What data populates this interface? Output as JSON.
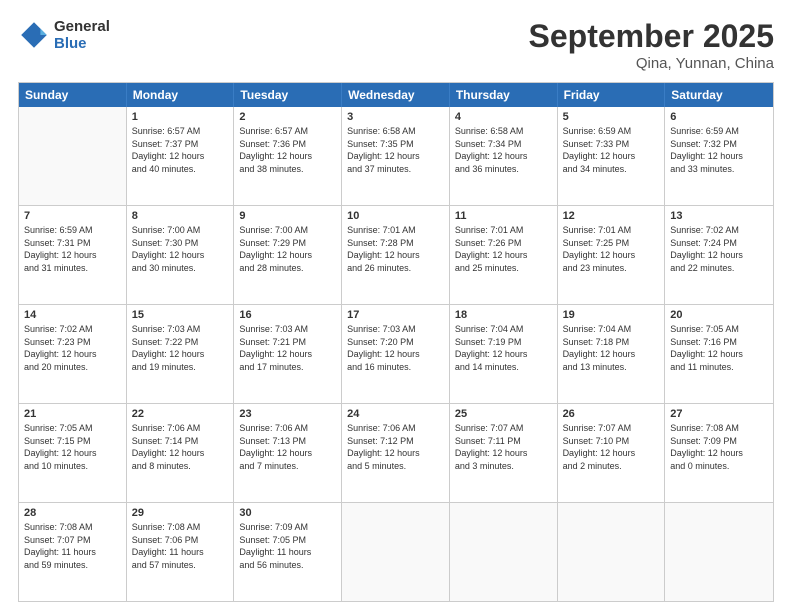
{
  "header": {
    "logo_line1": "General",
    "logo_line2": "Blue",
    "title": "September 2025",
    "subtitle": "Qina, Yunnan, China"
  },
  "days_of_week": [
    "Sunday",
    "Monday",
    "Tuesday",
    "Wednesday",
    "Thursday",
    "Friday",
    "Saturday"
  ],
  "weeks": [
    [
      {
        "day": "",
        "info": ""
      },
      {
        "day": "1",
        "info": "Sunrise: 6:57 AM\nSunset: 7:37 PM\nDaylight: 12 hours\nand 40 minutes."
      },
      {
        "day": "2",
        "info": "Sunrise: 6:57 AM\nSunset: 7:36 PM\nDaylight: 12 hours\nand 38 minutes."
      },
      {
        "day": "3",
        "info": "Sunrise: 6:58 AM\nSunset: 7:35 PM\nDaylight: 12 hours\nand 37 minutes."
      },
      {
        "day": "4",
        "info": "Sunrise: 6:58 AM\nSunset: 7:34 PM\nDaylight: 12 hours\nand 36 minutes."
      },
      {
        "day": "5",
        "info": "Sunrise: 6:59 AM\nSunset: 7:33 PM\nDaylight: 12 hours\nand 34 minutes."
      },
      {
        "day": "6",
        "info": "Sunrise: 6:59 AM\nSunset: 7:32 PM\nDaylight: 12 hours\nand 33 minutes."
      }
    ],
    [
      {
        "day": "7",
        "info": "Sunrise: 6:59 AM\nSunset: 7:31 PM\nDaylight: 12 hours\nand 31 minutes."
      },
      {
        "day": "8",
        "info": "Sunrise: 7:00 AM\nSunset: 7:30 PM\nDaylight: 12 hours\nand 30 minutes."
      },
      {
        "day": "9",
        "info": "Sunrise: 7:00 AM\nSunset: 7:29 PM\nDaylight: 12 hours\nand 28 minutes."
      },
      {
        "day": "10",
        "info": "Sunrise: 7:01 AM\nSunset: 7:28 PM\nDaylight: 12 hours\nand 26 minutes."
      },
      {
        "day": "11",
        "info": "Sunrise: 7:01 AM\nSunset: 7:26 PM\nDaylight: 12 hours\nand 25 minutes."
      },
      {
        "day": "12",
        "info": "Sunrise: 7:01 AM\nSunset: 7:25 PM\nDaylight: 12 hours\nand 23 minutes."
      },
      {
        "day": "13",
        "info": "Sunrise: 7:02 AM\nSunset: 7:24 PM\nDaylight: 12 hours\nand 22 minutes."
      }
    ],
    [
      {
        "day": "14",
        "info": "Sunrise: 7:02 AM\nSunset: 7:23 PM\nDaylight: 12 hours\nand 20 minutes."
      },
      {
        "day": "15",
        "info": "Sunrise: 7:03 AM\nSunset: 7:22 PM\nDaylight: 12 hours\nand 19 minutes."
      },
      {
        "day": "16",
        "info": "Sunrise: 7:03 AM\nSunset: 7:21 PM\nDaylight: 12 hours\nand 17 minutes."
      },
      {
        "day": "17",
        "info": "Sunrise: 7:03 AM\nSunset: 7:20 PM\nDaylight: 12 hours\nand 16 minutes."
      },
      {
        "day": "18",
        "info": "Sunrise: 7:04 AM\nSunset: 7:19 PM\nDaylight: 12 hours\nand 14 minutes."
      },
      {
        "day": "19",
        "info": "Sunrise: 7:04 AM\nSunset: 7:18 PM\nDaylight: 12 hours\nand 13 minutes."
      },
      {
        "day": "20",
        "info": "Sunrise: 7:05 AM\nSunset: 7:16 PM\nDaylight: 12 hours\nand 11 minutes."
      }
    ],
    [
      {
        "day": "21",
        "info": "Sunrise: 7:05 AM\nSunset: 7:15 PM\nDaylight: 12 hours\nand 10 minutes."
      },
      {
        "day": "22",
        "info": "Sunrise: 7:06 AM\nSunset: 7:14 PM\nDaylight: 12 hours\nand 8 minutes."
      },
      {
        "day": "23",
        "info": "Sunrise: 7:06 AM\nSunset: 7:13 PM\nDaylight: 12 hours\nand 7 minutes."
      },
      {
        "day": "24",
        "info": "Sunrise: 7:06 AM\nSunset: 7:12 PM\nDaylight: 12 hours\nand 5 minutes."
      },
      {
        "day": "25",
        "info": "Sunrise: 7:07 AM\nSunset: 7:11 PM\nDaylight: 12 hours\nand 3 minutes."
      },
      {
        "day": "26",
        "info": "Sunrise: 7:07 AM\nSunset: 7:10 PM\nDaylight: 12 hours\nand 2 minutes."
      },
      {
        "day": "27",
        "info": "Sunrise: 7:08 AM\nSunset: 7:09 PM\nDaylight: 12 hours\nand 0 minutes."
      }
    ],
    [
      {
        "day": "28",
        "info": "Sunrise: 7:08 AM\nSunset: 7:07 PM\nDaylight: 11 hours\nand 59 minutes."
      },
      {
        "day": "29",
        "info": "Sunrise: 7:08 AM\nSunset: 7:06 PM\nDaylight: 11 hours\nand 57 minutes."
      },
      {
        "day": "30",
        "info": "Sunrise: 7:09 AM\nSunset: 7:05 PM\nDaylight: 11 hours\nand 56 minutes."
      },
      {
        "day": "",
        "info": ""
      },
      {
        "day": "",
        "info": ""
      },
      {
        "day": "",
        "info": ""
      },
      {
        "day": "",
        "info": ""
      }
    ]
  ]
}
